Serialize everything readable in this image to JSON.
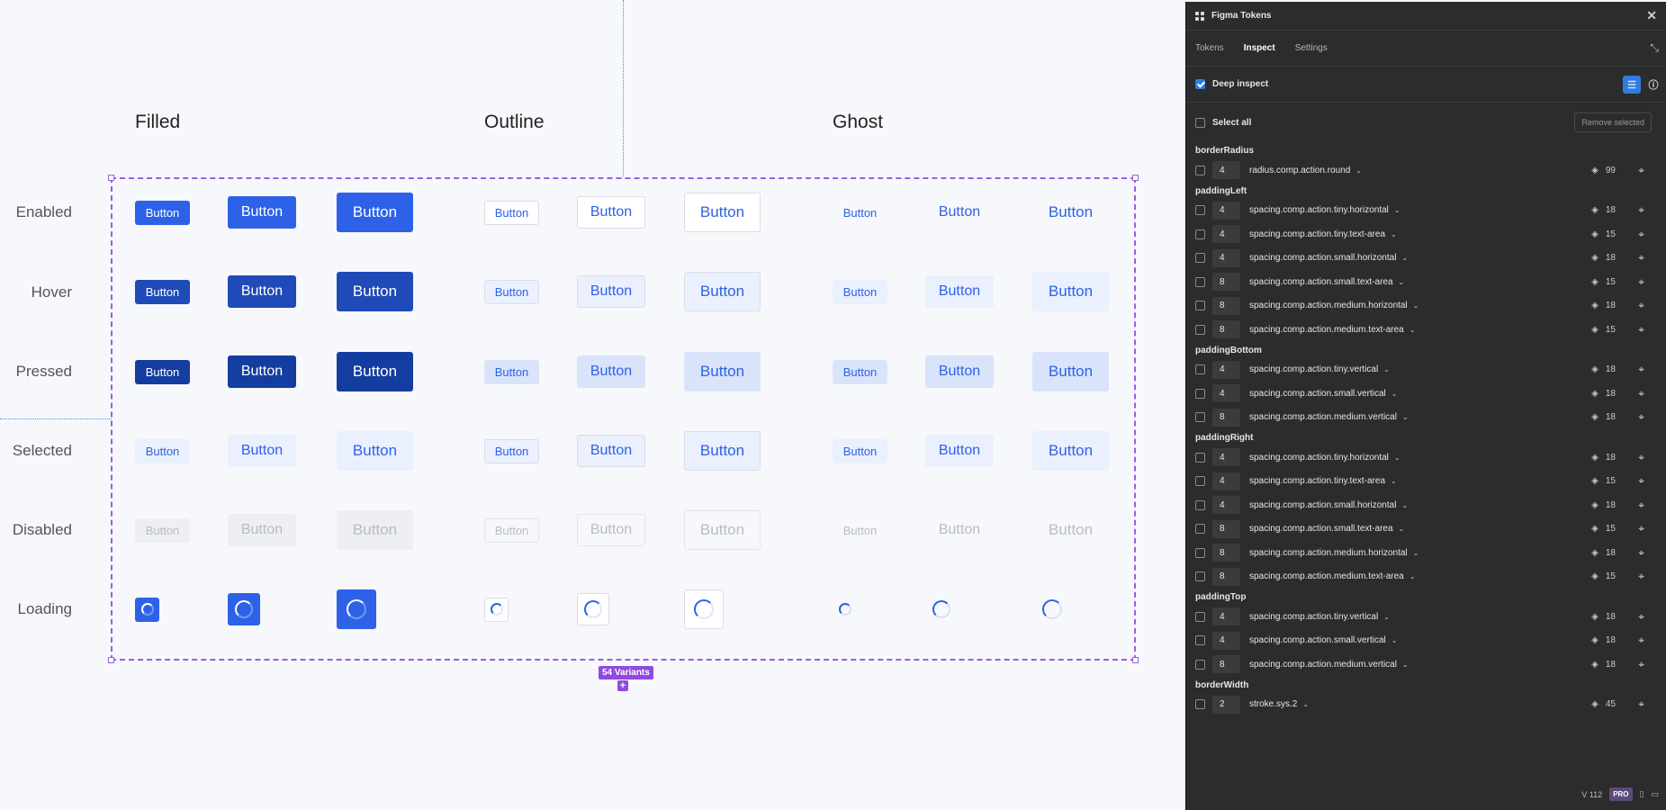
{
  "canvas": {
    "columns": [
      "Filled",
      "Outline",
      "Ghost"
    ],
    "rows": [
      "Enabled",
      "Hover",
      "Pressed",
      "Selected",
      "Disabled",
      "Loading"
    ],
    "button_label": "Button",
    "variants_badge": "54 Variants",
    "add_label": "+"
  },
  "plugin": {
    "title": "Figma Tokens",
    "tabs": [
      "Tokens",
      "Inspect",
      "Settings"
    ],
    "active_tab": "Inspect",
    "deep_inspect_label": "Deep inspect",
    "deep_inspect_checked": true,
    "select_all_label": "Select all",
    "remove_selected_label": "Remove selected",
    "groups": [
      {
        "name": "borderRadius",
        "items": [
          {
            "value": "4",
            "token": "radius.comp.action.round",
            "count": "99"
          }
        ]
      },
      {
        "name": "paddingLeft",
        "items": [
          {
            "value": "4",
            "token": "spacing.comp.action.tiny.horizontal",
            "count": "18"
          },
          {
            "value": "4",
            "token": "spacing.comp.action.tiny.text-area",
            "count": "15"
          },
          {
            "value": "4",
            "token": "spacing.comp.action.small.horizontal",
            "count": "18"
          },
          {
            "value": "8",
            "token": "spacing.comp.action.small.text-area",
            "count": "15"
          },
          {
            "value": "8",
            "token": "spacing.comp.action.medium.horizontal",
            "count": "18"
          },
          {
            "value": "8",
            "token": "spacing.comp.action.medium.text-area",
            "count": "15"
          }
        ]
      },
      {
        "name": "paddingBottom",
        "items": [
          {
            "value": "4",
            "token": "spacing.comp.action.tiny.vertical",
            "count": "18"
          },
          {
            "value": "4",
            "token": "spacing.comp.action.small.vertical",
            "count": "18"
          },
          {
            "value": "8",
            "token": "spacing.comp.action.medium.vertical",
            "count": "18"
          }
        ]
      },
      {
        "name": "paddingRight",
        "items": [
          {
            "value": "4",
            "token": "spacing.comp.action.tiny.horizontal",
            "count": "18"
          },
          {
            "value": "4",
            "token": "spacing.comp.action.tiny.text-area",
            "count": "15"
          },
          {
            "value": "4",
            "token": "spacing.comp.action.small.horizontal",
            "count": "18"
          },
          {
            "value": "8",
            "token": "spacing.comp.action.small.text-area",
            "count": "15"
          },
          {
            "value": "8",
            "token": "spacing.comp.action.medium.horizontal",
            "count": "18"
          },
          {
            "value": "8",
            "token": "spacing.comp.action.medium.text-area",
            "count": "15"
          }
        ]
      },
      {
        "name": "paddingTop",
        "items": [
          {
            "value": "4",
            "token": "spacing.comp.action.tiny.vertical",
            "count": "18"
          },
          {
            "value": "4",
            "token": "spacing.comp.action.small.vertical",
            "count": "18"
          },
          {
            "value": "8",
            "token": "spacing.comp.action.medium.vertical",
            "count": "18"
          }
        ]
      },
      {
        "name": "borderWidth",
        "items": [
          {
            "value": "2",
            "token": "stroke.sys.2",
            "count": "45"
          }
        ]
      }
    ],
    "footer": {
      "version": "V 112",
      "plan": "PRO"
    }
  },
  "colors": {
    "brand_blue": "#2d62e8",
    "panel_bg": "#2c2c2c",
    "frame_purple": "#9b5de5",
    "checkbox_blue": "#2f7de1"
  }
}
